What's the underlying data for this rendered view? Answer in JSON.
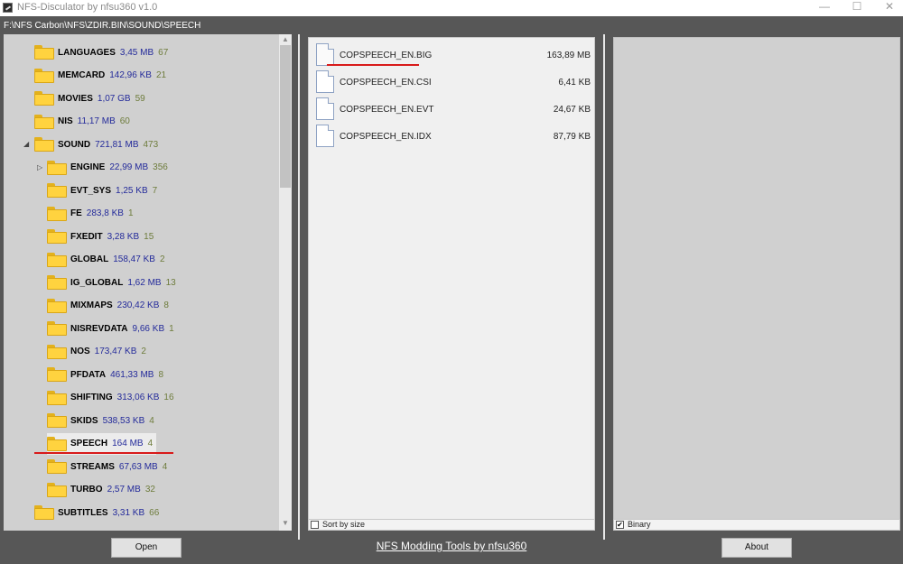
{
  "window": {
    "title": "NFS-Disculator by nfsu360 v1.0",
    "minimize_glyph": "—",
    "maximize_glyph": "☐",
    "close_glyph": "✕"
  },
  "path": "F:\\NFS Carbon\\NFS\\ZDIR.BIN\\SOUND\\SPEECH",
  "tree": [
    {
      "name": "LANGUAGES",
      "size": "3,45 MB",
      "count": "67"
    },
    {
      "name": "MEMCARD",
      "size": "142,96 KB",
      "count": "21"
    },
    {
      "name": "MOVIES",
      "size": "1,07 GB",
      "count": "59"
    },
    {
      "name": "NIS",
      "size": "11,17 MB",
      "count": "60"
    },
    {
      "name": "SOUND",
      "size": "721,81 MB",
      "count": "473"
    },
    {
      "name": "ENGINE",
      "size": "22,99 MB",
      "count": "356"
    },
    {
      "name": "EVT_SYS",
      "size": "1,25 KB",
      "count": "7"
    },
    {
      "name": "FE",
      "size": "283,8 KB",
      "count": "1"
    },
    {
      "name": "FXEDIT",
      "size": "3,28 KB",
      "count": "15"
    },
    {
      "name": "GLOBAL",
      "size": "158,47 KB",
      "count": "2"
    },
    {
      "name": "IG_GLOBAL",
      "size": "1,62 MB",
      "count": "13"
    },
    {
      "name": "MIXMAPS",
      "size": "230,42 KB",
      "count": "8"
    },
    {
      "name": "NISREVDATA",
      "size": "9,66 KB",
      "count": "1"
    },
    {
      "name": "NOS",
      "size": "173,47 KB",
      "count": "2"
    },
    {
      "name": "PFDATA",
      "size": "461,33 MB",
      "count": "8"
    },
    {
      "name": "SHIFTING",
      "size": "313,06 KB",
      "count": "16"
    },
    {
      "name": "SKIDS",
      "size": "538,53 KB",
      "count": "4"
    },
    {
      "name": "SPEECH",
      "size": "164 MB",
      "count": "4"
    },
    {
      "name": "STREAMS",
      "size": "67,63 MB",
      "count": "4"
    },
    {
      "name": "TURBO",
      "size": "2,57 MB",
      "count": "32"
    },
    {
      "name": "SUBTITLES",
      "size": "3,31 KB",
      "count": "66"
    }
  ],
  "expanders": {
    "sound": "◢",
    "engine": "▷"
  },
  "scroll": {
    "up": "▲",
    "down": "▼"
  },
  "files": [
    {
      "name": "COPSPEECH_EN.BIG",
      "size": "163,89 MB"
    },
    {
      "name": "COPSPEECH_EN.CSI",
      "size": "6,41 KB"
    },
    {
      "name": "COPSPEECH_EN.EVT",
      "size": "24,67 KB"
    },
    {
      "name": "COPSPEECH_EN.IDX",
      "size": "87,79 KB"
    }
  ],
  "sort_by_size": {
    "label": "Sort by size",
    "checked": false
  },
  "binary": {
    "label": "Binary",
    "checked": true,
    "mark": "✔"
  },
  "buttons": {
    "open": "Open",
    "about": "About"
  },
  "footer_link": "NFS Modding Tools by nfsu360",
  "annotation_color": "#d81a1a"
}
